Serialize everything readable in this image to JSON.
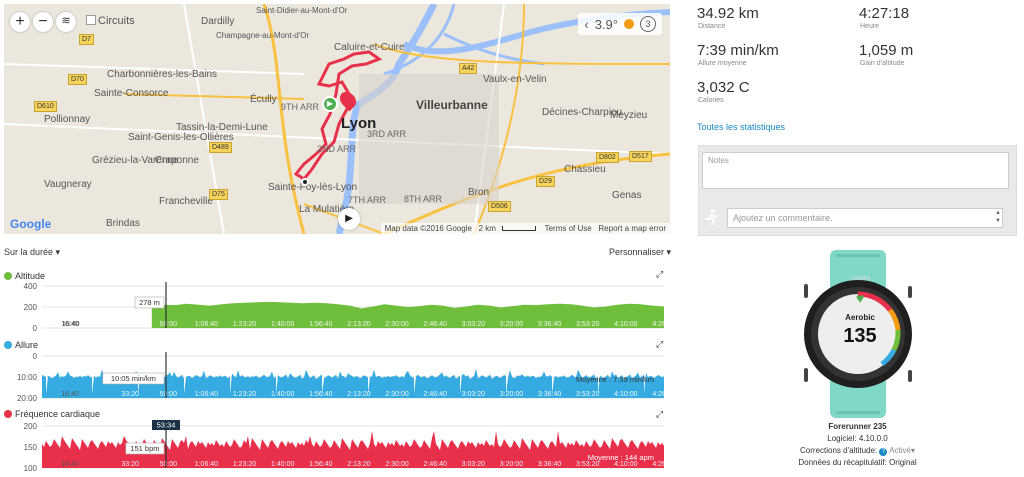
{
  "map": {
    "checkbox_label": "Circuits",
    "temperature": "3.9°",
    "wind": "3",
    "google": "Google",
    "attribution": {
      "data": "Map data ©2016 Google",
      "scale": "2 km",
      "terms": "Terms of Use",
      "report": "Report a map error"
    },
    "towns": [
      {
        "name": "Dardilly"
      },
      {
        "name": "Champagne-au-Mont-d'Or"
      },
      {
        "name": "Caluire-et-Cuire"
      },
      {
        "name": "Charbonnières-les-Bains"
      },
      {
        "name": "Sainte-Consorce"
      },
      {
        "name": "Vaulx-en-Velin"
      },
      {
        "name": "Pollionnay"
      },
      {
        "name": "Écully"
      },
      {
        "name": "Villeurbanne"
      },
      {
        "name": "Lyon"
      },
      {
        "name": "Saint-Genis-les-Ollières"
      },
      {
        "name": "Tassin-la-Demi-Lune"
      },
      {
        "name": "Décines-Charpieu"
      },
      {
        "name": "Meyzieu"
      },
      {
        "name": "Grézieu-la-Varenne"
      },
      {
        "name": "Craponne"
      },
      {
        "name": "Vaugneray"
      },
      {
        "name": "Chassieu"
      },
      {
        "name": "Francheville"
      },
      {
        "name": "Sainte-Foy-lès-Lyon"
      },
      {
        "name": "Bron"
      },
      {
        "name": "Genas"
      },
      {
        "name": "La Mulatière"
      },
      {
        "name": "Brindas"
      },
      {
        "name": "3RD ARR"
      },
      {
        "name": "9TH ARR"
      },
      {
        "name": "8TH ARR"
      },
      {
        "name": "2ND ARR"
      },
      {
        "name": "7TH ARR"
      },
      {
        "name": "Saint-Didier-au-Mont-d'Or"
      }
    ]
  },
  "stats": [
    {
      "value": "34.92 km",
      "label": "Distance"
    },
    {
      "value": "4:27:18",
      "label": "Heure"
    },
    {
      "value": "7:39 min/km",
      "label": "Allure moyenne"
    },
    {
      "value": "1,059 m",
      "label": "Gain d'altitude"
    },
    {
      "value": "3,032 C",
      "label": "Calories"
    }
  ],
  "all_stats_link": "Toutes les statistiques",
  "notes_placeholder": "Notes",
  "comment_placeholder": "Ajoutez un commentaire.",
  "charts_header": {
    "left": "Sur la durée",
    "right": "Personnaliser"
  },
  "colors": {
    "altitude": "#6fbe3c",
    "allure": "#35abe2",
    "hr": "#e8304b",
    "link": "#1a8ac6",
    "watch_teal": "#7fd8c8"
  },
  "x_ticks": [
    "16:40",
    "33:20",
    "50:00",
    "1:06:40",
    "1:23:20",
    "1:40:00",
    "1:56:40",
    "2:13:20",
    "2:30:00",
    "2:46:40",
    "3:03:20",
    "3:20:00",
    "3:36:40",
    "3:53:20",
    "4:10:00",
    "4:26:40"
  ],
  "chart_data": [
    {
      "type": "area",
      "title": "Altitude",
      "y_ticks": [
        "400",
        "200",
        "0"
      ],
      "ylim": [
        0,
        450
      ],
      "x": [
        0,
        2,
        4,
        6,
        8,
        10,
        12,
        14,
        16,
        18,
        20,
        22,
        24,
        26,
        28,
        30,
        32,
        34,
        36,
        38,
        40,
        42,
        44,
        46,
        48,
        50,
        52,
        54,
        56,
        58,
        60,
        62,
        64,
        66,
        68,
        70,
        72,
        74,
        76,
        78,
        80,
        82,
        84,
        86,
        88,
        90,
        92,
        94,
        96,
        98,
        100
      ],
      "values": [
        0,
        0,
        0,
        0,
        0,
        0,
        260,
        250,
        245,
        260,
        250,
        240,
        255,
        265,
        270,
        275,
        280,
        275,
        270,
        265,
        270,
        265,
        255,
        240,
        210,
        230,
        255,
        240,
        225,
        235,
        250,
        240,
        215,
        230,
        250,
        240,
        220,
        235,
        250,
        245,
        255,
        260,
        255,
        240,
        220,
        230,
        250,
        260,
        255,
        240,
        230
      ],
      "tooltip_time": "16:40",
      "tooltip_value": "278 m"
    },
    {
      "type": "area",
      "title": "Allure",
      "y_ticks": [
        "0",
        "10:00",
        "20:00"
      ],
      "tooltip_value": "10:05 min/km",
      "average_label": "Moyenne : 7:39 min/km"
    },
    {
      "type": "area",
      "title": "Fréquence cardiaque",
      "y_ticks": [
        "200",
        "150",
        "100"
      ],
      "tooltip_time": "53:34",
      "tooltip_value": "151 bpm",
      "average_label": "Moyenne : 144 apm"
    }
  ],
  "watch": {
    "brand": "GARMIN",
    "mode": "Aerobic",
    "hr": "135",
    "heart": "♥"
  },
  "device": {
    "name": "Forerunner 235",
    "software": "Logiciel: 4.10.0.0",
    "altitude_corrections": "Corrections d'altitude",
    "altitude_state": "Activé",
    "summary": "Données du récapitulatif: Original"
  }
}
